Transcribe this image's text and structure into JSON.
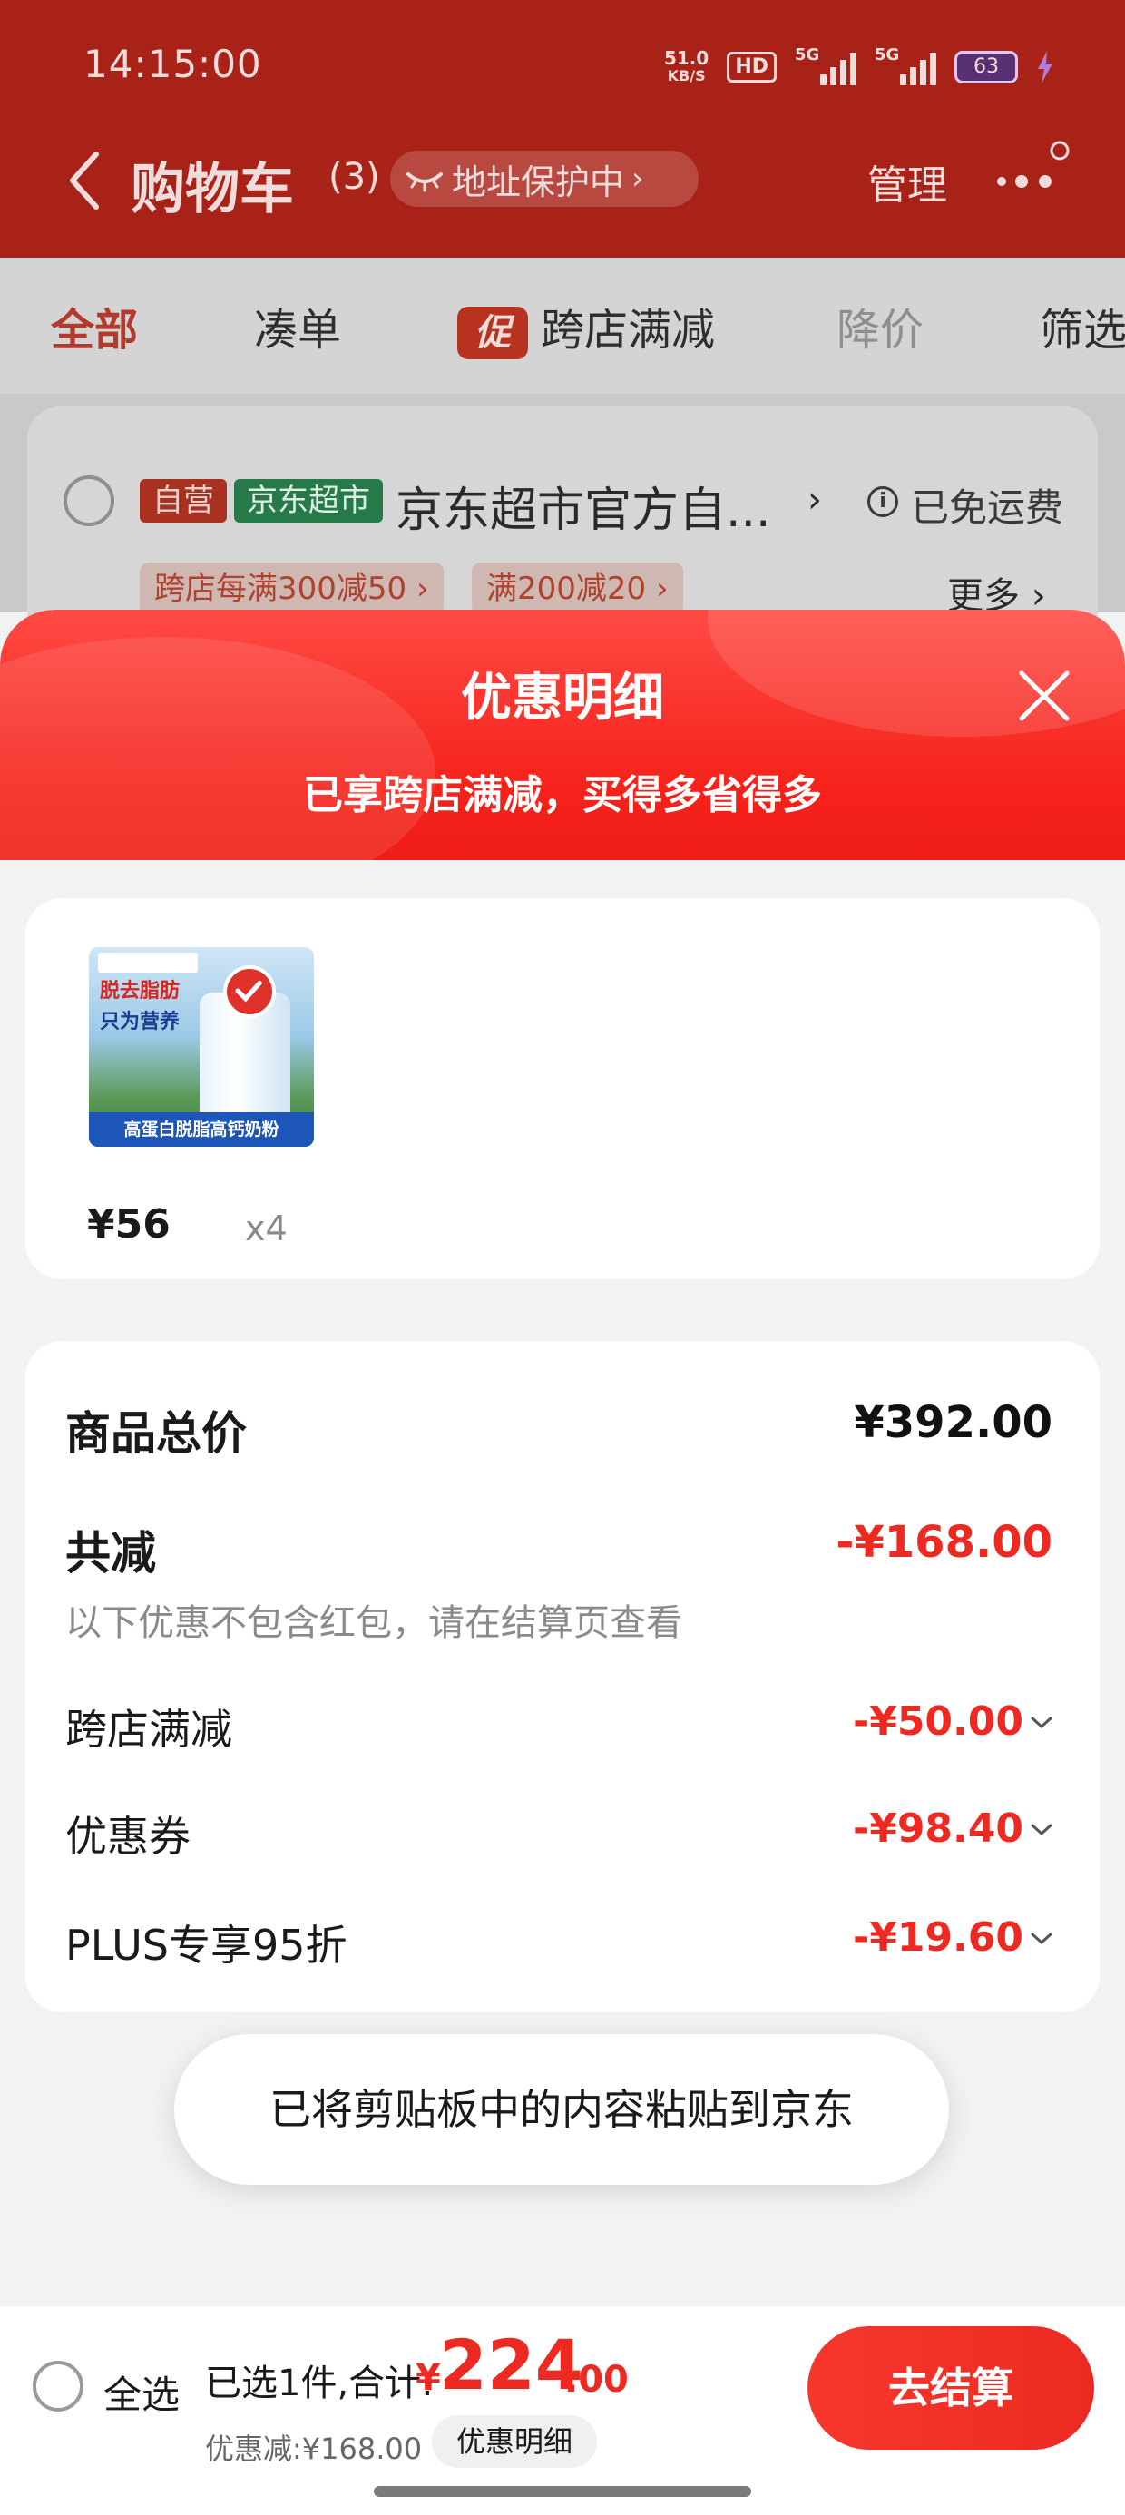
{
  "status_bar": {
    "time": "14:15:00",
    "net_speed_value": "51.0",
    "net_speed_unit": "KB/S",
    "hd_label": "HD",
    "signal1_label": "5G",
    "signal2_label": "5G",
    "battery": "63",
    "battery_color": "#5a3075"
  },
  "header": {
    "title": "购物车",
    "count": "(3)",
    "address_protect": "地址保护中",
    "manage": "管理"
  },
  "tabs": [
    {
      "label": "全部",
      "active": true
    },
    {
      "label": "凑单"
    },
    {
      "label": "跨店满减",
      "badge": "促"
    },
    {
      "label": "降价"
    },
    {
      "label": "筛选"
    }
  ],
  "shop": {
    "tag_self": "自营",
    "tag_super": "京东超市",
    "name": "京东超市官方自...",
    "free_shipping": "已免运费",
    "promos": [
      "跨店每满300减50",
      "满200减20"
    ],
    "more": "更多"
  },
  "sheet": {
    "title": "优惠明细",
    "subtitle": "已享跨店满减，买得多省得多"
  },
  "product": {
    "image_text_head": "脱去脂肪",
    "image_text_head2": "只为营养",
    "image_footer": "高蛋白脱脂高钙奶粉",
    "price": "¥56",
    "quantity": "x4"
  },
  "summary": {
    "total_label": "商品总价",
    "total_value": "¥392.00",
    "reduce_label": "共减",
    "reduce_value": "-¥168.00",
    "note": "以下优惠不包含红包，请在结算页查看",
    "items": [
      {
        "label": "跨店满减",
        "value": "-¥50.00"
      },
      {
        "label": "优惠券",
        "value": "-¥98.40"
      },
      {
        "label": "PLUS专享95折",
        "value": "-¥19.60"
      }
    ]
  },
  "toast": "已将剪贴板中的内容粘贴到京东",
  "bottom_bar": {
    "select_all": "全选",
    "selected_summary": "已选1件,合计:",
    "currency": "¥",
    "total_int": "224",
    "total_dec": ".00",
    "discount_label": "优惠减:¥168.00",
    "detail_button": "优惠明细",
    "checkout": "去结算"
  },
  "colors": {
    "accent_red": "#ec2a21",
    "header_dim_red": "#a82218"
  }
}
